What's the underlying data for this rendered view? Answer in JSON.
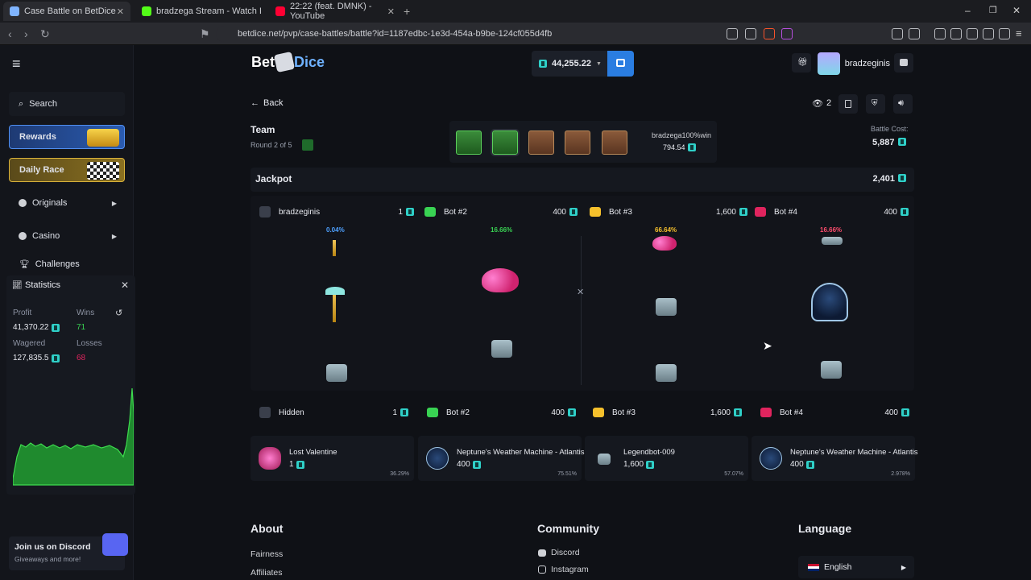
{
  "browser": {
    "tabs": [
      {
        "title": "Case Battle on BetDice",
        "active": true
      },
      {
        "title": "bradzega Stream - Watch Live on Ki"
      },
      {
        "title": "22:22 (feat. DMNK) - YouTube"
      }
    ],
    "url": "betdice.net/pvp/case-battles/battle?id=1187edbc-1e3d-454a-b9be-124cf055d4fb"
  },
  "sidebar": {
    "search": "Search",
    "rewards": "Rewards",
    "daily_race": "Daily Race",
    "originals": "Originals",
    "casino": "Casino",
    "challenges": "Challenges"
  },
  "stats": {
    "title": "Statistics",
    "profit_label": "Profit",
    "profit": "41,370.22",
    "wins_label": "Wins",
    "wins": "71",
    "wagered_label": "Wagered",
    "wagered": "127,835.5",
    "losses_label": "Losses",
    "losses": "68"
  },
  "discord_promo": {
    "title": "Join us on Discord",
    "subtitle": "Giveaways and more!"
  },
  "header": {
    "logo_bet": "Bet",
    "logo_dice": "Dice",
    "balance": "44,255.22",
    "username": "bradzeginis"
  },
  "battle": {
    "back": "Back",
    "mode": "Team",
    "round": "Round 2 of 5",
    "viewers": "2",
    "leader_name": "bradzega100%win",
    "leader_value": "794.54",
    "cost_label": "Battle Cost:",
    "cost": "5,887",
    "jackpot_label": "Jackpot",
    "jackpot_value": "2,401"
  },
  "players": [
    {
      "name": "bradzeginis",
      "value": "1",
      "pct": "0.04%",
      "pct_color": "#4ea1ff"
    },
    {
      "name": "Bot #2",
      "value": "400",
      "pct": "16.66%",
      "pct_color": "#39d353"
    },
    {
      "name": "Bot #3",
      "value": "1,600",
      "pct": "66.64%",
      "pct_color": "#f5c02c"
    },
    {
      "name": "Bot #4",
      "value": "400",
      "pct": "16.66%",
      "pct_color": "#ff4d6d"
    }
  ],
  "results": [
    {
      "name": "Hidden",
      "value": "1"
    },
    {
      "name": "Bot #2",
      "value": "400"
    },
    {
      "name": "Bot #3",
      "value": "1,600"
    },
    {
      "name": "Bot #4",
      "value": "400"
    }
  ],
  "drops": [
    {
      "name": "Lost Valentine",
      "price": "1",
      "chance": "36.29%"
    },
    {
      "name": "Neptune's Weather Machine - Atlantis",
      "price": "400",
      "chance": "75.51%"
    },
    {
      "name": "Legendbot-009",
      "price": "1,600",
      "chance": "57.07%"
    },
    {
      "name": "Neptune's Weather Machine - Atlantis",
      "price": "400",
      "chance": "2.978%"
    }
  ],
  "footer": {
    "about": "About",
    "fairness": "Fairness",
    "affiliates": "Affiliates",
    "community": "Community",
    "discord": "Discord",
    "instagram": "Instagram",
    "language": "Language",
    "lang_value": "English"
  },
  "colors": {
    "accent": "#2a7de1",
    "coin": "#2fd0c8",
    "win": "#39d353",
    "loss": "#e0245e"
  }
}
